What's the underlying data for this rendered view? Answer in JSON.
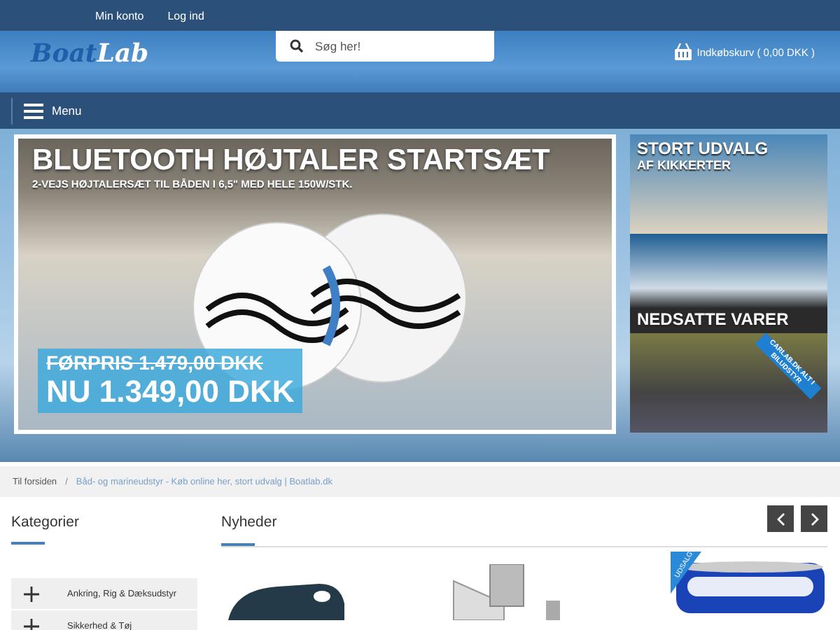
{
  "top_links": [
    "Min konto",
    "Log ind"
  ],
  "logo": {
    "part_1": "Boat",
    "part_2": "Lab"
  },
  "search": {
    "placeholder": "Søg her!"
  },
  "cart": {
    "label": "Indkøbskurv ( 0,00 DKK )"
  },
  "menu": {
    "label": "Menu"
  },
  "hero": {
    "title": "BLUETOOTH HØJTALER STARTSÆT",
    "subtitle": "2-VEJS HØJTALERSÆT TIL BÅDEN I 6,5\" MED HELE 150W/STK.",
    "old_price": "FØRPRIS 1.479,00 DKK",
    "price": "NU 1.349,00 DKK"
  },
  "side_banners": [
    {
      "kind": "binoculars",
      "title": "STORT UDVALG",
      "subtitle": "AF KIKKERTER"
    },
    {
      "kind": "boat",
      "title": "NEDSATTE VARER"
    },
    {
      "kind": "car",
      "ribbon": "CARLAB.DK ALT I BILUDSTYR"
    }
  ],
  "breadcrumb_separator": "/",
  "breadcrumb": [
    {
      "label": "Til forsiden"
    },
    {
      "label": "Båd- og marineudstyr - Køb online her, stort udvalg | Boatlab.dk"
    }
  ],
  "categories": {
    "title": "Kategorier",
    "items": [
      "Ankring, Rig & Dæksudstyr",
      "Sikkerhed & Tøj"
    ]
  },
  "news": {
    "title": "Nyheder",
    "products": [
      {
        "kind": "gasket"
      },
      {
        "kind": "bracket"
      },
      {
        "kind": "paint",
        "badge": "UDSALG"
      }
    ]
  }
}
